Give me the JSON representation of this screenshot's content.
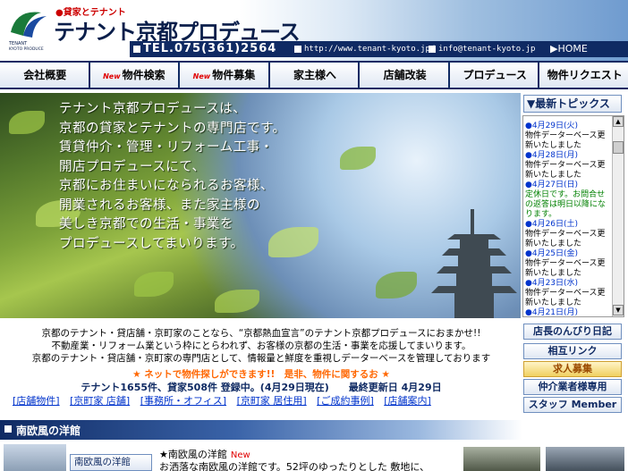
{
  "header": {
    "tagline": "貸家とテナント",
    "brand": "テナント京都プロデュース",
    "logo_text": "TENANT KYOTO PRODUCE",
    "phone": "TEL.075(361)2564",
    "url": "http://www.tenant-kyoto.jp/",
    "email": "info@tenant-kyoto.jp",
    "home": "HOME"
  },
  "nav": {
    "items": [
      {
        "label": "会社概要",
        "new": ""
      },
      {
        "label": "物件検索",
        "new": "New"
      },
      {
        "label": "物件募集",
        "new": "New"
      },
      {
        "label": "家主様へ",
        "new": ""
      },
      {
        "label": "店舗改装",
        "new": ""
      },
      {
        "label": "プロデュース",
        "new": ""
      },
      {
        "label": "物件リクエスト",
        "new": ""
      }
    ]
  },
  "hero": {
    "lines": [
      "テナント京都プロデュースは、",
      "京都の貸家とテナントの専門店です。",
      "賃貸仲介・管理・リフォーム工事・",
      "開店プロデュースにて、",
      "京都にお住まいになられるお客様、",
      "開業されるお客様、また家主様の",
      "美しき京都での生活・事業を",
      "プロデュースしてまいります。"
    ]
  },
  "sidebar": {
    "topics_title": "▼最新トピックス",
    "topics": [
      {
        "date": "4月29日(火)",
        "text": "物件データーベース更新いたしました",
        "green": false
      },
      {
        "date": "4月28日(月)",
        "text": "物件データーベース更新いたしました",
        "green": false
      },
      {
        "date": "4月27日(日)",
        "text": "定休日です。お問合せの返答は明日以降になります。",
        "green": true
      },
      {
        "date": "4月26日(土)",
        "text": "物件データーベース更新いたしました",
        "green": false
      },
      {
        "date": "4月25日(金)",
        "text": "物件データーベース更新いたしました",
        "green": false
      },
      {
        "date": "4月23日(水)",
        "text": "物件データーベース更新いたしました",
        "green": false
      },
      {
        "date": "4月21日(月)",
        "text": "",
        "green": false
      }
    ],
    "buttons": {
      "diary": "店長のんびり日記",
      "links": "相互リンク",
      "recruit": "求人募集",
      "agents": "仲介業者様専用",
      "staff": "スタッフ Member"
    }
  },
  "intro": {
    "line1": "京都のテナント・貸店舗・京町家のことなら、“京都熱血宣言”のテナント京都プロデュースにおまかせ!!",
    "line2": "不動産業・リフォーム業という枠にとらわれず、お客様の京都の生活・事業を応援してまいります。",
    "line3": "京都のテナント・貸店舗・京町家の専門店として、情報量と鮮度を重視しデーターベースを管理しております",
    "promo": "★ ネットで物件探しができます!!　是非、物件に関するお ★",
    "count": "テナント1655件、貸家508件 登録中。(4月29日現在)　　最終更新日 4月29日"
  },
  "quick_links": [
    "[店舗物件]",
    "[京町家 店舗]",
    "[事務所・オフィス]",
    "[京町家 居住用]",
    "[ご成約事例]",
    "[店舗案内]"
  ],
  "section": {
    "title": "南欧風の洋館",
    "label": "南欧風の洋館",
    "item_title": "★南欧風の洋館",
    "item_new": "New",
    "item_desc": "お洒落な南欧風の洋館です。52坪のゆったりとした 敷地に、"
  },
  "colors": {
    "navy": "#0f2a63",
    "accent_red": "#e00000",
    "link_blue": "#0033cc",
    "promo_orange": "#ff6600"
  }
}
